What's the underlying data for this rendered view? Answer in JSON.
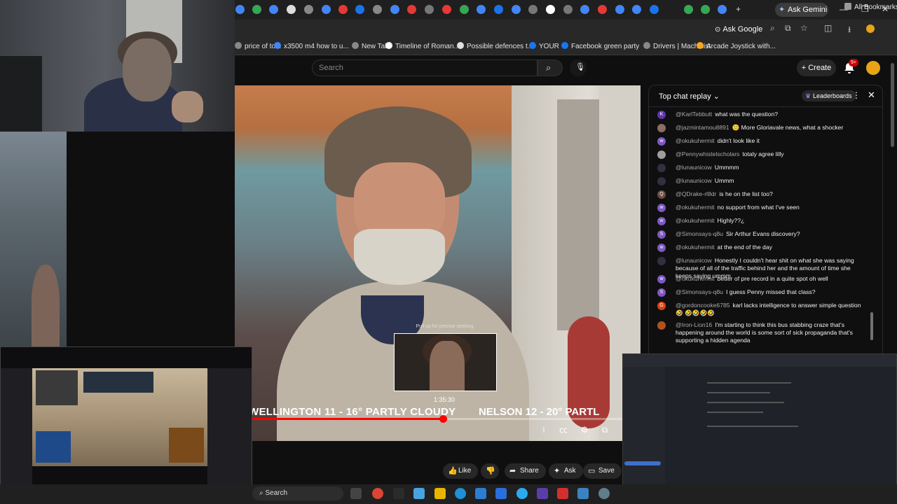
{
  "browser": {
    "ask_gemini": "Ask Gemini",
    "ask_google": "Ask Google",
    "bookmarks": [
      {
        "label": "price of to...",
        "icon_color": "#888888"
      },
      {
        "label": "x3500 m4 how to u...",
        "icon_color": "#4285f4"
      },
      {
        "label": "New Tab",
        "icon_color": "#888888"
      },
      {
        "label": "Timeline of Roman...",
        "icon_color": "#ffffff"
      },
      {
        "label": "Possible defences t...",
        "icon_color": "#e0e0e0"
      },
      {
        "label": "YOUR",
        "icon_color": "#1877f2"
      },
      {
        "label": "Facebook green party",
        "icon_color": "#1877f2"
      },
      {
        "label": "Drivers | Machinist",
        "icon_color": "#888888"
      },
      {
        "label": "Arcade Joystick with...",
        "icon_color": "#f5a623"
      }
    ],
    "all_bookmarks": "All Bookmarks"
  },
  "youtube": {
    "search_placeholder": "Search",
    "create_label": "Create",
    "notif_count": "9+"
  },
  "video": {
    "ticker_left": "WELLINGTON 11 - 16° PARTLY CLOUDY",
    "ticker_right": "NELSON 12 - 20° PARTL",
    "preview_hint": "Pull up for precise seeking",
    "preview_time": "1:35:30",
    "progress": 0.51
  },
  "actions": {
    "like": "Like",
    "share": "Share",
    "ask": "Ask",
    "save": "Save"
  },
  "chat": {
    "title": "Top chat replay",
    "leaderboards": "Leaderboards",
    "messages": [
      {
        "author": "@KarlTebbutt",
        "text": "what was the question?",
        "av": "K",
        "color": "#5e35b1"
      },
      {
        "author": "@jazmintamou8891",
        "text": "🙂 More Gloriavale news, what a shocker",
        "av": "",
        "color": "#8d6e63"
      },
      {
        "author": "@okukuhermit",
        "text": "didn't look like it",
        "av": "w",
        "color": "#7e57c2"
      },
      {
        "author": "@Pennywhistelscholars",
        "text": "totaly agree lilly",
        "av": "",
        "color": "#9e9e9e"
      },
      {
        "author": "@lunaunicow",
        "text": "Ummmm",
        "av": "",
        "color": "#303040"
      },
      {
        "author": "@lunaunicow",
        "text": "Ummm",
        "av": "",
        "color": "#303040"
      },
      {
        "author": "@QDrake-rl8dr",
        "text": "is he on the list too?",
        "av": "Q",
        "color": "#6d4c41"
      },
      {
        "author": "@okukuhermit",
        "text": "no support from what I've seen",
        "av": "w",
        "color": "#7e57c2"
      },
      {
        "author": "@okukuhermit",
        "text": "Highly??¿",
        "av": "w",
        "color": "#7e57c2"
      },
      {
        "author": "@Simonsays-q8u",
        "text": "Sir Arthur Evans discovery?",
        "av": "S",
        "color": "#7e57c2"
      },
      {
        "author": "@okukuhermit",
        "text": "at the end of the day",
        "av": "w",
        "color": "#7e57c2"
      },
      {
        "author": "@lunaunicow",
        "text": "Honestly I couldn't hear shit on what she was saying because of all of the traffic behind her and the amount of time she keeps saying ummm",
        "av": "",
        "color": "#303040"
      },
      {
        "author": "@okukuhermit",
        "text": "better of pre record in a quite spot oh well",
        "av": "w",
        "color": "#7e57c2"
      },
      {
        "author": "@Simonsays-q8u",
        "text": "I guess Penny missed that class?",
        "av": "S",
        "color": "#7e57c2"
      },
      {
        "author": "@gordoncooke6785",
        "text": "karl lacks intelligence to answer simple question 🤣 🤣🤣🤣🤣",
        "av": "G",
        "color": "#d84315"
      },
      {
        "author": "@Iron-Lion16",
        "text": "I'm starting to think this bus stabbing craze that's happening around the world is some sort of sick propaganda that's supporting a hidden agenda",
        "av": "",
        "color": "#b0521e"
      }
    ]
  },
  "taskbar": {
    "search_label": "Search"
  }
}
